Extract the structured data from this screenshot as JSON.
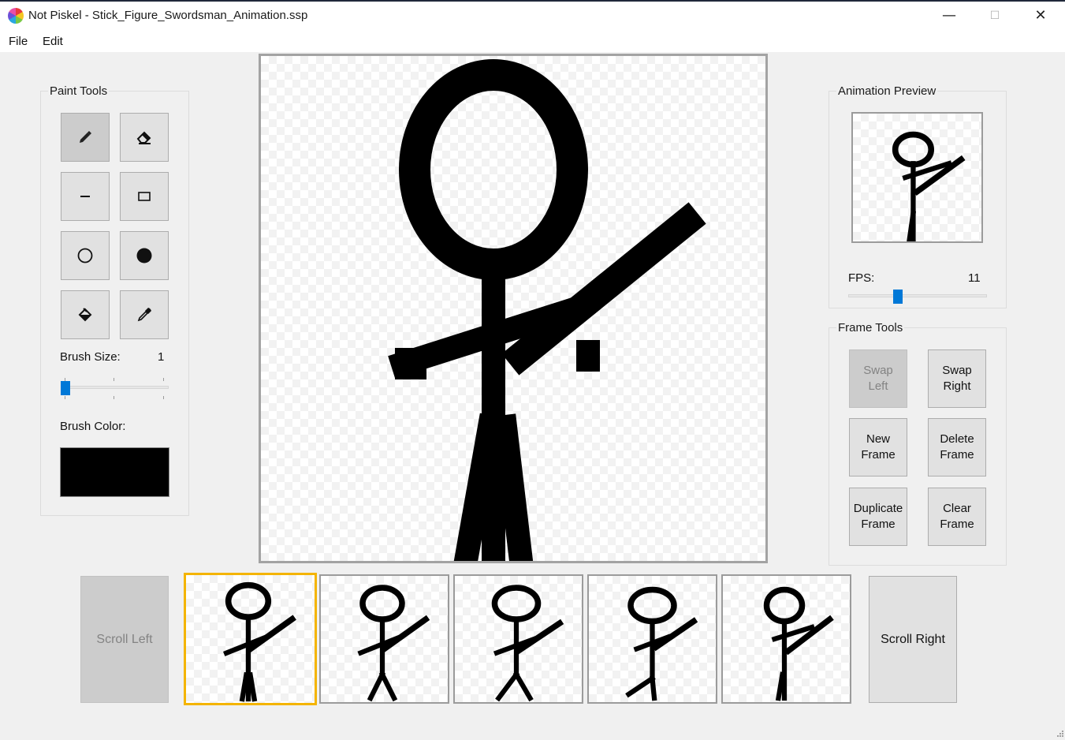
{
  "window": {
    "app_name": "Not Piskel",
    "title": "Not Piskel - Stick_Figure_Swordsman_Animation.ssp",
    "minimize": "—",
    "maximize": "☐",
    "close": "✕"
  },
  "menu": {
    "items": [
      "File",
      "Edit"
    ]
  },
  "paint_tools": {
    "label": "Paint Tools",
    "tools": [
      {
        "name": "pencil",
        "icon": "pencil-icon",
        "active": true
      },
      {
        "name": "eraser",
        "icon": "eraser-icon",
        "active": false
      },
      {
        "name": "line",
        "icon": "line-icon",
        "active": false
      },
      {
        "name": "rectangle",
        "icon": "rectangle-icon",
        "active": false
      },
      {
        "name": "circle",
        "icon": "circle-outline-icon",
        "active": false
      },
      {
        "name": "filled-circle",
        "icon": "filled-circle-icon",
        "active": false
      },
      {
        "name": "fill",
        "icon": "paint-bucket-icon",
        "active": false
      },
      {
        "name": "eyedropper",
        "icon": "eyedropper-icon",
        "active": false
      }
    ],
    "brush_size_label": "Brush Size:",
    "brush_size_value": "1",
    "brush_size_level": 0.0,
    "brush_color_label": "Brush Color:",
    "brush_color": "#000000"
  },
  "animation_preview": {
    "label": "Animation Preview",
    "fps_label": "FPS:",
    "fps_value": "11",
    "fps_level": 0.35
  },
  "frame_tools": {
    "label": "Frame Tools",
    "buttons": [
      {
        "label": "Swap\nLeft",
        "enabled": false
      },
      {
        "label": "Swap\nRight",
        "enabled": true
      },
      {
        "label": "New\nFrame",
        "enabled": true
      },
      {
        "label": "Delete\nFrame",
        "enabled": true
      },
      {
        "label": "Duplicate\nFrame",
        "enabled": true
      },
      {
        "label": "Clear\nFrame",
        "enabled": true
      }
    ]
  },
  "timeline": {
    "scroll_left": "Scroll Left",
    "scroll_left_enabled": false,
    "scroll_right": "Scroll Right",
    "scroll_right_enabled": true,
    "frame_count": 5,
    "selected_frame": 0
  },
  "colors": {
    "accent": "#0078d7",
    "selection": "#f4b400"
  }
}
